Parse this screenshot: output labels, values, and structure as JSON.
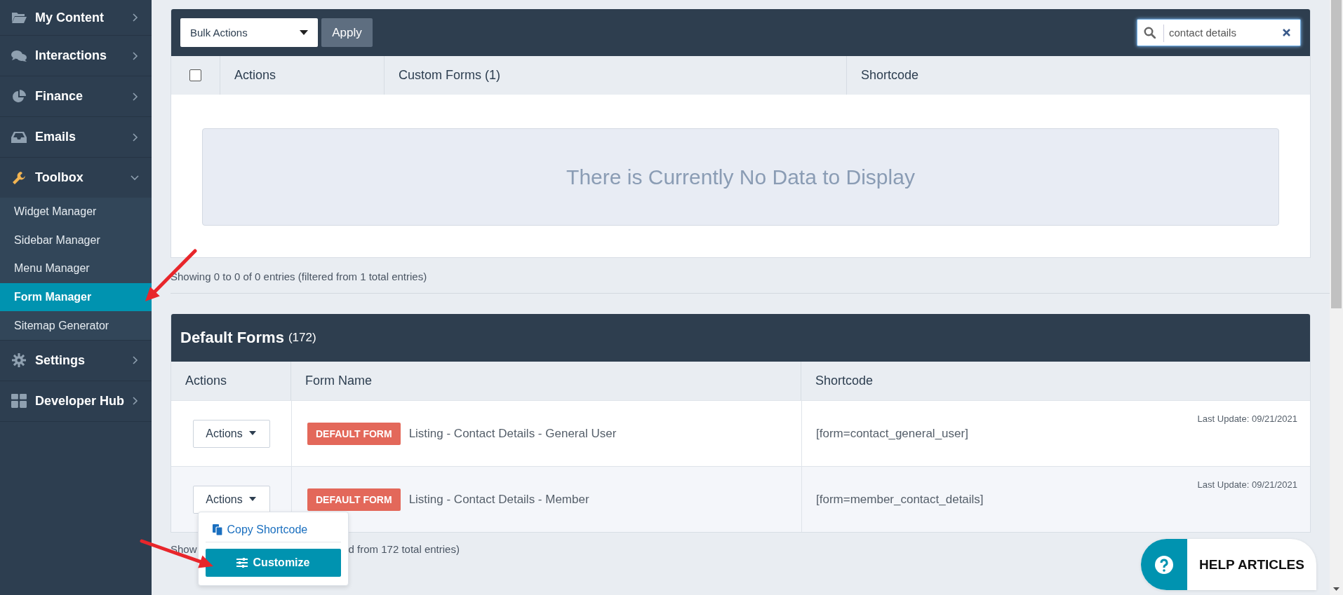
{
  "sidebar": {
    "items": [
      {
        "label": "My Content",
        "expanded": false
      },
      {
        "label": "Interactions",
        "expanded": false
      },
      {
        "label": "Finance",
        "expanded": false
      },
      {
        "label": "Emails",
        "expanded": false
      },
      {
        "label": "Toolbox",
        "expanded": true,
        "children": [
          {
            "label": "Widget Manager",
            "selected": false
          },
          {
            "label": "Sidebar Manager",
            "selected": false
          },
          {
            "label": "Menu Manager",
            "selected": false
          },
          {
            "label": "Form Manager",
            "selected": true
          },
          {
            "label": "Sitemap Generator",
            "selected": false
          }
        ]
      },
      {
        "label": "Settings",
        "expanded": false
      },
      {
        "label": "Developer Hub",
        "expanded": false
      }
    ]
  },
  "custom_forms": {
    "bulk_actions": "Bulk Actions",
    "apply": "Apply",
    "search": {
      "value": "contact details"
    },
    "select_all": {
      "checked": false
    },
    "columns": [
      "Actions",
      "Custom Forms (1)",
      "Shortcode"
    ],
    "empty_message": "There is Currently No Data to Display",
    "footer": "Showing 0 to 0 of 0 entries (filtered from 1 total entries)"
  },
  "default_forms": {
    "title": "Default Forms",
    "count": "(172)",
    "columns": [
      "Actions",
      "Form Name",
      "Shortcode"
    ],
    "rows": [
      {
        "actions": "Actions",
        "badge": "DEFAULT FORM",
        "name": "Listing - Contact Details - General User",
        "shortcode": "[form=contact_general_user]",
        "last_update": "Last Update: 09/21/2021",
        "menu_open": false
      },
      {
        "actions": "Actions",
        "badge": "DEFAULT FORM",
        "name": "Listing - Contact Details - Member",
        "shortcode": "[form=member_contact_details]",
        "last_update": "Last Update: 09/21/2021",
        "menu_open": true
      }
    ],
    "footer_parts": [
      "Show",
      "d from 172 total entries)"
    ]
  },
  "actions_menu": {
    "items": [
      {
        "kind": "link",
        "label": "Copy Shortcode"
      },
      {
        "kind": "button",
        "label": "Customize"
      }
    ]
  },
  "help": {
    "label": "HELP ARTICLES"
  }
}
